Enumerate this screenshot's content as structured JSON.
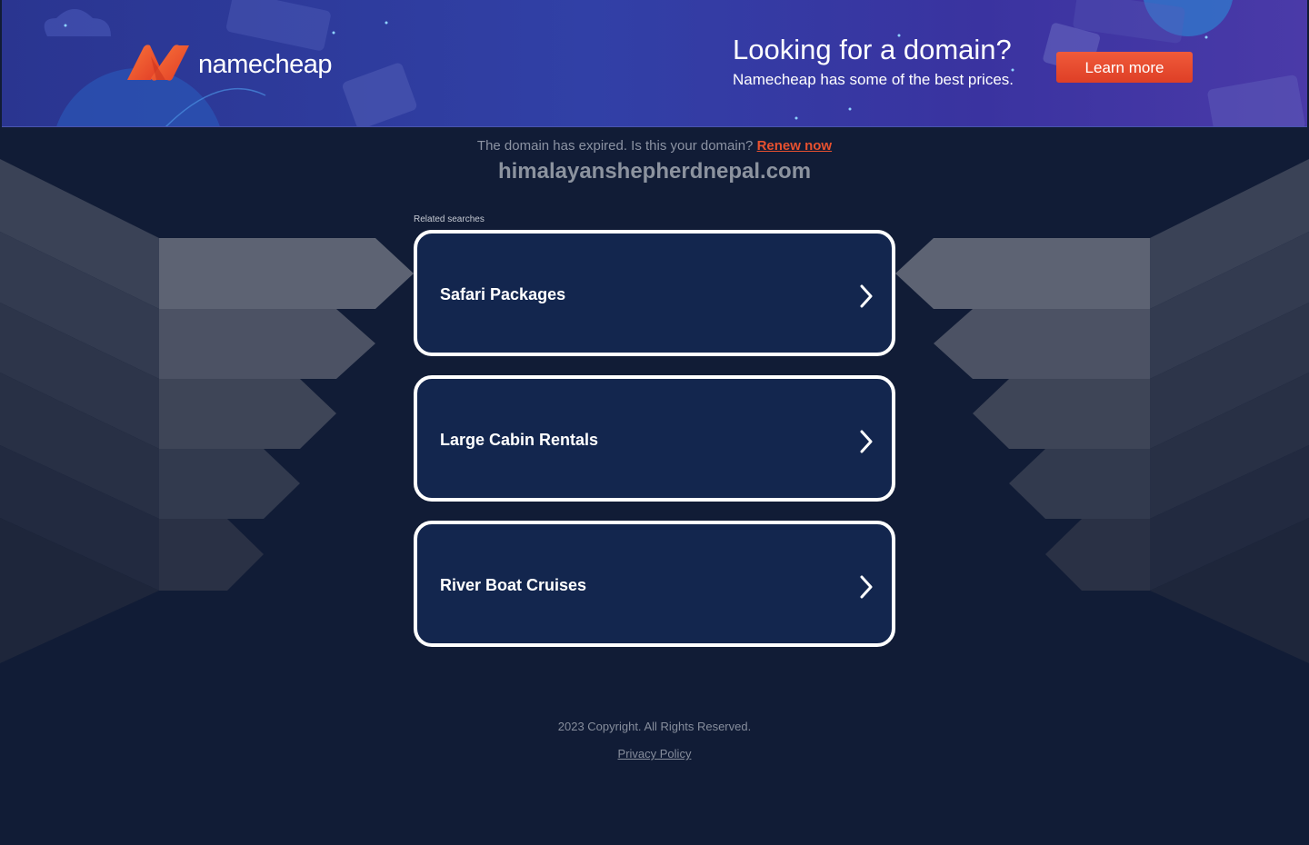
{
  "banner": {
    "logo_text": "namecheap",
    "promo_title": "Looking for a domain?",
    "promo_subtitle": "Namecheap has some of the best prices.",
    "cta_label": "Learn more",
    "colors": {
      "brand_orange": "#f05a3a",
      "banner_blue": "#3140a6"
    }
  },
  "notice": {
    "expired_text": "The domain has expired. Is this your domain?",
    "renew_label": "Renew now",
    "domain": "himalayanshepherdnepal.com"
  },
  "related": {
    "label": "Related searches",
    "items": [
      {
        "label": "Safari Packages",
        "icon": "chevron-right-icon"
      },
      {
        "label": "Large Cabin Rentals",
        "icon": "chevron-right-icon"
      },
      {
        "label": "River Boat Cruises",
        "icon": "chevron-right-icon"
      }
    ]
  },
  "footer": {
    "copyright": "2023 Copyright. All Rights Reserved.",
    "privacy_label": "Privacy Policy"
  }
}
